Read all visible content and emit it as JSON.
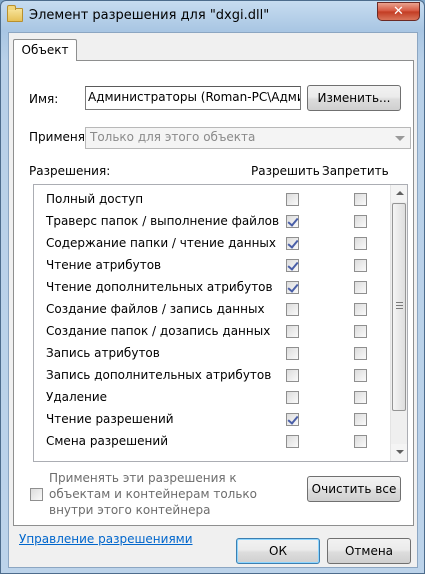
{
  "window": {
    "title": "Элемент разрешения для \"dxgi.dll\"",
    "close_label": "✕"
  },
  "tabs": [
    {
      "label": "Объект"
    }
  ],
  "name_field": {
    "label": "Имя:",
    "value": "Администраторы (Roman-PC\\Админ",
    "change_button": "Изменить..."
  },
  "apply_to": {
    "label": "Применять:",
    "value": "Только для этого объекта"
  },
  "permissions": {
    "header": "Разрешения:",
    "allow_header": "Разрешить",
    "deny_header": "Запретить",
    "rows": [
      {
        "name": "Полный доступ",
        "allow": false,
        "deny": false
      },
      {
        "name": "Траверс папок / выполнение файлов",
        "allow": true,
        "deny": false
      },
      {
        "name": "Содержание папки / чтение данных",
        "allow": true,
        "deny": false
      },
      {
        "name": "Чтение атрибутов",
        "allow": true,
        "deny": false
      },
      {
        "name": "Чтение дополнительных атрибутов",
        "allow": true,
        "deny": false
      },
      {
        "name": "Создание файлов / запись данных",
        "allow": false,
        "deny": false
      },
      {
        "name": "Создание папок / дозапись данных",
        "allow": false,
        "deny": false
      },
      {
        "name": "Запись атрибутов",
        "allow": false,
        "deny": false
      },
      {
        "name": "Запись дополнительных атрибутов",
        "allow": false,
        "deny": false
      },
      {
        "name": "Удаление",
        "allow": false,
        "deny": false
      },
      {
        "name": "Чтение разрешений",
        "allow": true,
        "deny": false
      },
      {
        "name": "Смена разрешений",
        "allow": false,
        "deny": false
      }
    ]
  },
  "apply_inside": {
    "text": "Применять эти разрешения к объектам и контейнерам только внутри этого контейнера"
  },
  "clear_button": "Очистить все",
  "manage_link": "Управление разрешениями",
  "ok_button": "ОК",
  "cancel_button": "Отмена"
}
